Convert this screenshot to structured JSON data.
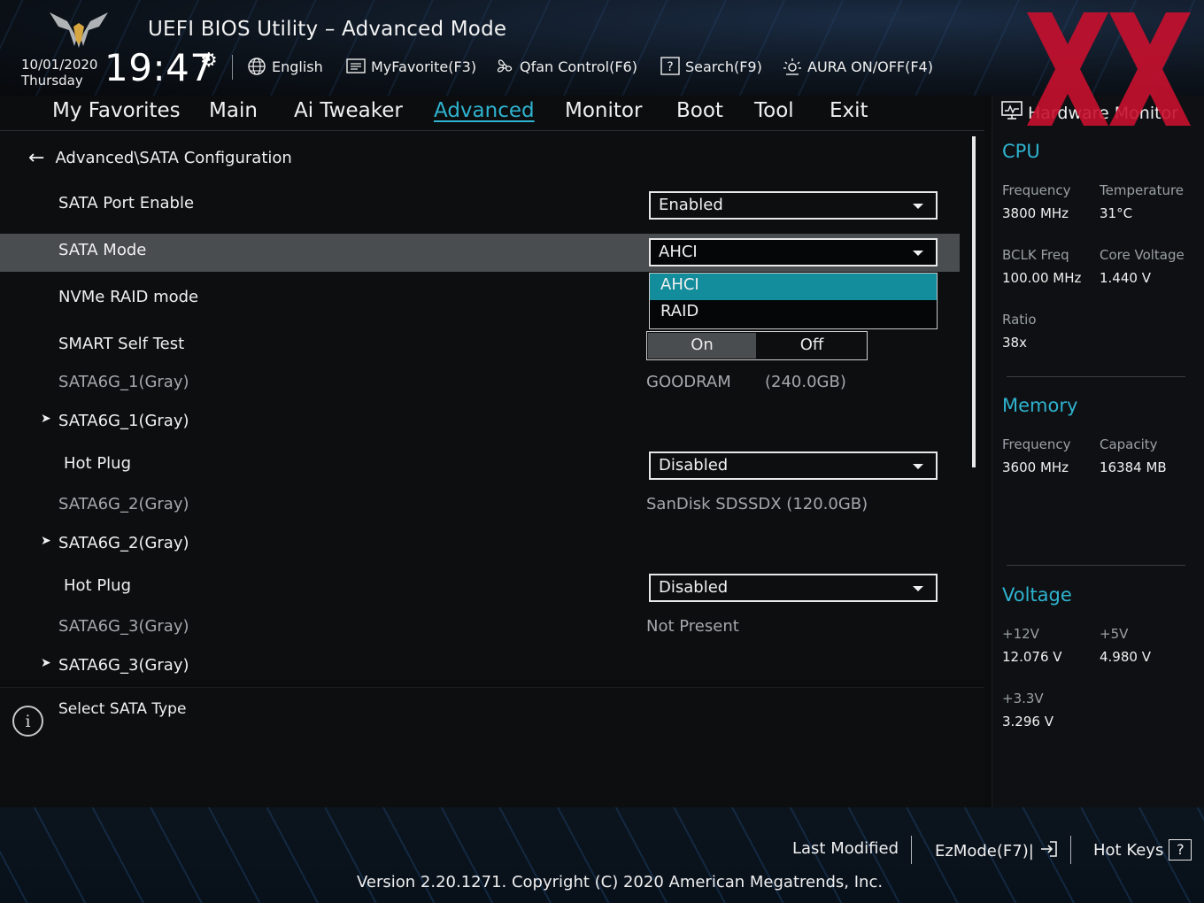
{
  "header": {
    "title": "UEFI BIOS Utility – Advanced Mode",
    "date": "10/01/2020",
    "day": "Thursday",
    "time": "19:47",
    "toolbar": [
      {
        "label": "English",
        "icon": "globe-icon"
      },
      {
        "label": "MyFavorite(F3)",
        "icon": "favorite-list-icon"
      },
      {
        "label": "Qfan Control(F6)",
        "icon": "fan-icon"
      },
      {
        "label": "Search(F9)",
        "icon": "search-help-icon"
      },
      {
        "label": "AURA ON/OFF(F4)",
        "icon": "aura-light-icon"
      }
    ]
  },
  "nav": {
    "tabs": [
      "My Favorites",
      "Main",
      "Ai Tweaker",
      "Advanced",
      "Monitor",
      "Boot",
      "Tool",
      "Exit"
    ],
    "active": "Advanced"
  },
  "main": {
    "breadcrumb": "Advanced\\SATA Configuration",
    "rows": {
      "sata_port_enable": {
        "label": "SATA Port Enable",
        "value": "Enabled"
      },
      "sata_mode": {
        "label": "SATA Mode",
        "value": "AHCI"
      },
      "nvme_raid": {
        "label": "NVMe RAID mode"
      },
      "smart_self_test": {
        "label": "SMART Self Test",
        "on": "On",
        "off": "Off"
      },
      "port1_info": {
        "label": "SATA6G_1(Gray)",
        "value": "GOODRAM",
        "size": "(240.0GB)"
      },
      "port1_sub": {
        "label": "SATA6G_1(Gray)"
      },
      "port1_hotplug": {
        "label": "Hot Plug",
        "value": "Disabled"
      },
      "port2_info": {
        "label": "SATA6G_2(Gray)",
        "value": "SanDisk SDSSDX (120.0GB)"
      },
      "port2_sub": {
        "label": "SATA6G_2(Gray)"
      },
      "port2_hotplug": {
        "label": "Hot Plug",
        "value": "Disabled"
      },
      "port3_info": {
        "label": "SATA6G_3(Gray)",
        "value": "Not Present"
      },
      "port3_sub": {
        "label": "SATA6G_3(Gray)"
      }
    },
    "dropdown_options": [
      "AHCI",
      "RAID"
    ],
    "dropdown_selected": "AHCI"
  },
  "help": {
    "text": "Select SATA Type"
  },
  "hw_monitor": {
    "title": "Hardware Monitor",
    "cpu": {
      "heading": "CPU",
      "frequency_label": "Frequency",
      "frequency": "3800 MHz",
      "temperature_label": "Temperature",
      "temperature": "31°C",
      "bclk_label": "BCLK Freq",
      "bclk": "100.00 MHz",
      "core_voltage_label": "Core Voltage",
      "core_voltage": "1.440 V",
      "ratio_label": "Ratio",
      "ratio": "38x"
    },
    "memory": {
      "heading": "Memory",
      "frequency_label": "Frequency",
      "frequency": "3600 MHz",
      "capacity_label": "Capacity",
      "capacity": "16384 MB"
    },
    "voltage": {
      "heading": "Voltage",
      "v12_label": "+12V",
      "v12": "12.076 V",
      "v5_label": "+5V",
      "v5": "4.980 V",
      "v33_label": "+3.3V",
      "v33": "3.296 V"
    }
  },
  "footer": {
    "last_modified": "Last Modified",
    "ezmode": "EzMode(F7)|",
    "hot_keys": "Hot Keys",
    "hot_keys_icon_label": "?",
    "version": "Version 2.20.1271. Copyright (C) 2020 American Megatrends, Inc."
  },
  "colors": {
    "accent": "#2fb3cf",
    "dropdown_selected": "#138c9c",
    "row_highlight": "#4a4d50",
    "watermark": "#c8102e"
  }
}
